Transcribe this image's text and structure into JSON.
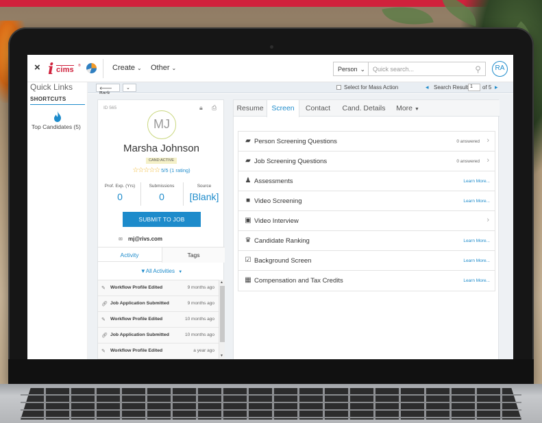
{
  "topnav": {
    "close_glyph": "×",
    "logo_i": "i",
    "logo_text": "cims",
    "logo_mark": "®",
    "create": "Create",
    "other": "Other",
    "chevron": "⌄",
    "person": "Person",
    "search_placeholder": "Quick search...",
    "avatar": "RA"
  },
  "sidebar": {
    "title": "Quick Links",
    "shortcuts": "SHORTCUTS",
    "top_candidates": "Top Candidates (5)"
  },
  "toolbar": {
    "back": "Back",
    "mass_action": "Select for Mass Action",
    "search_result": "Search Result",
    "page": "1",
    "of": "of 5"
  },
  "candidate": {
    "id": "ID 565",
    "initials": "MJ",
    "name": "Marsha Johnson",
    "status": "CAND:ACTIVE",
    "stars": "☆☆☆☆☆",
    "rating": "5/5 (1 rating)",
    "stats": [
      {
        "label": "Prof. Exp. (Yrs)",
        "value": "0"
      },
      {
        "label": "Submissions",
        "value": "0"
      },
      {
        "label": "Source",
        "value": "[Blank]"
      }
    ],
    "submit": "SUBMIT TO JOB",
    "email": "mj@rivs.com",
    "tabs": {
      "activity": "Activity",
      "tags": "Tags"
    },
    "filter": "All Activities",
    "activities": [
      {
        "icon": "edit",
        "title": "Workflow Profile Edited",
        "date": "9 months ago"
      },
      {
        "icon": "link",
        "title": "Job Application Submitted",
        "date": "9 months ago"
      },
      {
        "icon": "edit",
        "title": "Workflow Profile Edited",
        "date": "10 months ago"
      },
      {
        "icon": "link",
        "title": "Job Application Submitted",
        "date": "10 months ago"
      },
      {
        "icon": "edit",
        "title": "Workflow Profile Edited",
        "date": "a year ago"
      }
    ]
  },
  "panel": {
    "tabs": [
      "Resume",
      "Screen",
      "Contact",
      "Cand. Details",
      "More"
    ],
    "active_tab": "Screen",
    "rows": [
      {
        "icon": "folder-icon",
        "label": "Person Screening Questions",
        "right": "0 answered",
        "arrow": true
      },
      {
        "icon": "folder-icon",
        "label": "Job Screening Questions",
        "right": "0 answered",
        "arrow": true
      },
      {
        "icon": "assessment-icon",
        "label": "Assessments",
        "right": "Learn More...",
        "arrow": false
      },
      {
        "icon": "video-camera-icon",
        "label": "Video Screening",
        "right": "Learn More...",
        "arrow": false
      },
      {
        "icon": "film-icon",
        "label": "Video Interview",
        "right": "",
        "arrow": true
      },
      {
        "icon": "trophy-icon",
        "label": "Candidate Ranking",
        "right": "Learn More...",
        "arrow": false
      },
      {
        "icon": "checkbox-icon",
        "label": "Background Screen",
        "right": "Learn More...",
        "arrow": false
      },
      {
        "icon": "calculator-icon",
        "label": "Compensation and Tax Credits",
        "right": "Learn More...",
        "arrow": false
      }
    ]
  },
  "colors": {
    "accent": "#1d8bcb",
    "brand_red": "#d0213c",
    "star": "#f0b323"
  }
}
